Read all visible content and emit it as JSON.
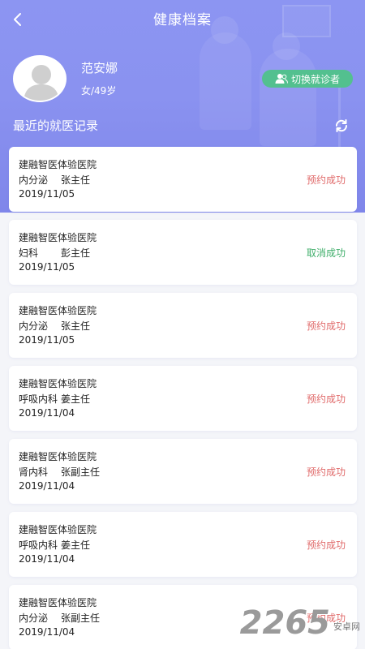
{
  "header": {
    "title": "健康档案",
    "bg_color": "#8a92f0"
  },
  "user": {
    "name": "范安娜",
    "meta": "女/49岁"
  },
  "switch_button": {
    "label": "切换就诊者",
    "color": "#53c08f"
  },
  "records_section": {
    "title": "最近的就医记录"
  },
  "records": [
    {
      "hospital": "建融智医体验医院",
      "dept": "内分泌",
      "doctor": "张主任",
      "date": "2019/11/05",
      "status": "预约成功",
      "status_color": "#e06a6a"
    },
    {
      "hospital": "建融智医体验医院",
      "dept": "妇科",
      "doctor": "彭主任",
      "date": "2019/11/05",
      "status": "取消成功",
      "status_color": "#3fae6a"
    },
    {
      "hospital": "建融智医体验医院",
      "dept": "内分泌",
      "doctor": "张主任",
      "date": "2019/11/05",
      "status": "预约成功",
      "status_color": "#e06a6a"
    },
    {
      "hospital": "建融智医体验医院",
      "dept": "呼吸内科",
      "doctor": "姜主任",
      "date": "2019/11/04",
      "status": "预约成功",
      "status_color": "#e06a6a"
    },
    {
      "hospital": "建融智医体验医院",
      "dept": "肾内科",
      "doctor": "张副主任",
      "date": "2019/11/04",
      "status": "预约成功",
      "status_color": "#e06a6a"
    },
    {
      "hospital": "建融智医体验医院",
      "dept": "呼吸内科",
      "doctor": "姜主任",
      "date": "2019/11/04",
      "status": "预约成功",
      "status_color": "#e06a6a"
    },
    {
      "hospital": "建融智医体验医院",
      "dept": "内分泌",
      "doctor": "张副主任",
      "date": "2019/11/04",
      "status": "预约成功",
      "status_color": "#e06a6a"
    }
  ],
  "watermark": {
    "number": "2265",
    "sub": "安卓网"
  }
}
